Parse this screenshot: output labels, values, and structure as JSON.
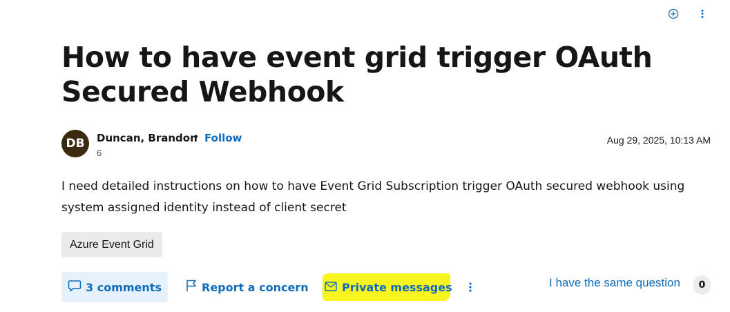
{
  "top_actions": {
    "add_icon": "plus-circle-icon",
    "more_icon": "more-vertical-icon"
  },
  "question": {
    "title": "How to have event grid trigger OAuth Secured Webhook",
    "body": "I need detailed instructions on how to have Event Grid Subscription trigger OAuth secured webhook using system assigned identity instead of client secret",
    "tag": "Azure Event Grid"
  },
  "author": {
    "initials": "DB",
    "name": "Duncan, Brandon",
    "separator": "•",
    "follow_label": "Follow",
    "reputation": "6",
    "timestamp": "Aug 29, 2025, 10:13 AM",
    "avatar_color": "#3b2a0f"
  },
  "actions": {
    "comments_label": "3 comments",
    "report_label": "Report a concern",
    "private_messages_label": "Private messages",
    "same_question_label": "I have the same question",
    "same_question_count": "0"
  },
  "colors": {
    "link": "#0f6cbd",
    "highlight": "#f7f51d",
    "tag_bg": "#ebebeb",
    "comments_bg": "#e5f1fb"
  }
}
